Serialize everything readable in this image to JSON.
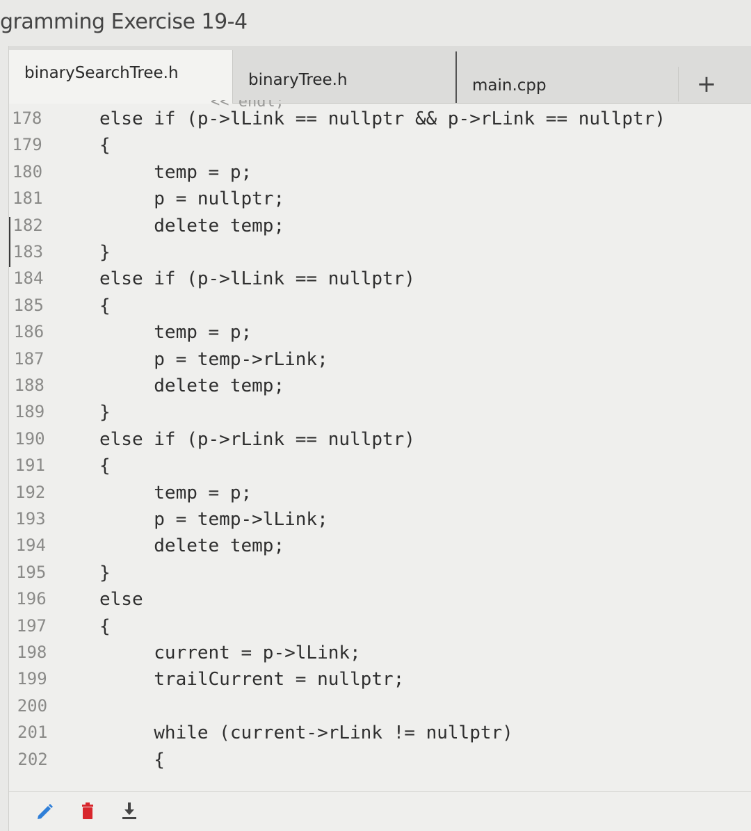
{
  "page": {
    "title": "gramming Exercise 19-4"
  },
  "tabs": [
    {
      "label": "binarySearchTree.h",
      "active": true
    },
    {
      "label": "binaryTree.h",
      "active": false
    },
    {
      "label": "main.cpp",
      "active": false
    }
  ],
  "add_tab_label": "+",
  "partial_line": "<< endl;",
  "code_lines": [
    {
      "num": "178",
      "text": "else if (p->lLink == nullptr && p->rLink == nullptr)"
    },
    {
      "num": "179",
      "text": "{"
    },
    {
      "num": "180",
      "text": "     temp = p;"
    },
    {
      "num": "181",
      "text": "     p = nullptr;"
    },
    {
      "num": "182",
      "text": "     delete temp;"
    },
    {
      "num": "183",
      "text": "}"
    },
    {
      "num": "184",
      "text": "else if (p->lLink == nullptr)"
    },
    {
      "num": "185",
      "text": "{"
    },
    {
      "num": "186",
      "text": "     temp = p;"
    },
    {
      "num": "187",
      "text": "     p = temp->rLink;"
    },
    {
      "num": "188",
      "text": "     delete temp;"
    },
    {
      "num": "189",
      "text": "}"
    },
    {
      "num": "190",
      "text": "else if (p->rLink == nullptr)"
    },
    {
      "num": "191",
      "text": "{"
    },
    {
      "num": "192",
      "text": "     temp = p;"
    },
    {
      "num": "193",
      "text": "     p = temp->lLink;"
    },
    {
      "num": "194",
      "text": "     delete temp;"
    },
    {
      "num": "195",
      "text": "}"
    },
    {
      "num": "196",
      "text": "else"
    },
    {
      "num": "197",
      "text": "{"
    },
    {
      "num": "198",
      "text": "     current = p->lLink;"
    },
    {
      "num": "199",
      "text": "     trailCurrent = nullptr;"
    },
    {
      "num": "200",
      "text": ""
    },
    {
      "num": "201",
      "text": "     while (current->rLink != nullptr)"
    },
    {
      "num": "202",
      "text": "     {"
    }
  ],
  "toolbar": {
    "edit_icon": "pencil-icon",
    "delete_icon": "trash-icon",
    "download_icon": "download-icon",
    "edit_color": "#2f7fd8",
    "delete_color": "#d8262c",
    "download_color": "#444444"
  }
}
